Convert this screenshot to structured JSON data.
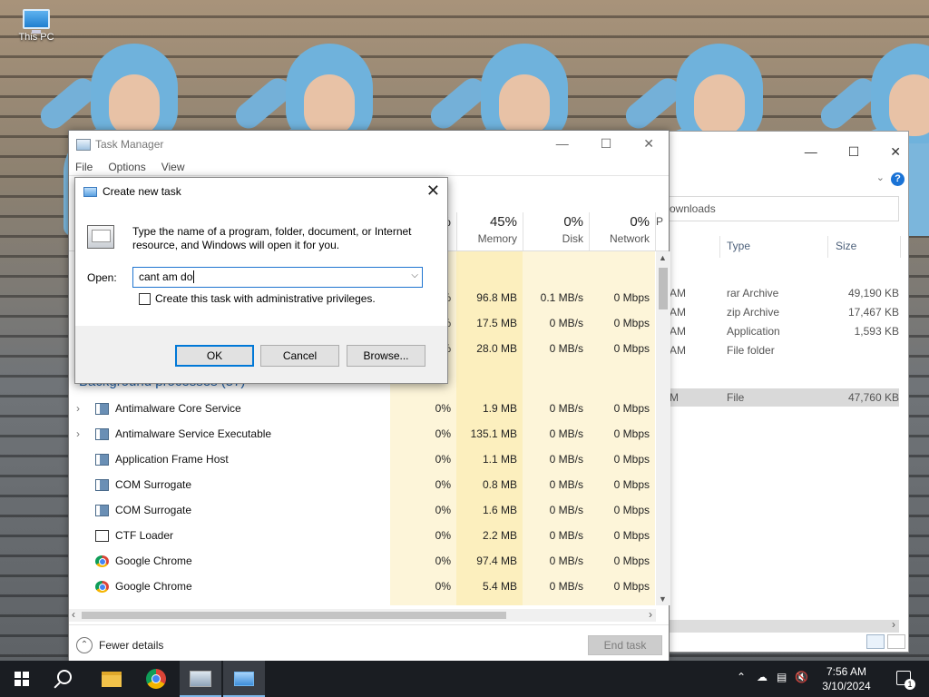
{
  "desktop": {
    "icons": [
      {
        "label": "This PC",
        "icon": "this-pc-icon"
      }
    ]
  },
  "explorer": {
    "address": "ownloads",
    "columns": [
      "Type",
      "Size"
    ],
    "rows": [
      {
        "date": "AM",
        "type": "rar Archive",
        "size": "49,190 KB"
      },
      {
        "date": "AM",
        "type": "zip Archive",
        "size": "17,467 KB"
      },
      {
        "date": "AM",
        "type": "Application",
        "size": "1,593 KB"
      },
      {
        "date": "AM",
        "type": "File folder",
        "size": ""
      },
      {
        "date": "M",
        "type": "File",
        "size": "47,760 KB",
        "selected": true
      }
    ]
  },
  "taskManager": {
    "title": "Task Manager",
    "menu": [
      "File",
      "Options",
      "View"
    ],
    "columns": [
      {
        "pct": "%",
        "label": ""
      },
      {
        "pct": "45%",
        "label": "Memory"
      },
      {
        "pct": "0%",
        "label": "Disk"
      },
      {
        "pct": "0%",
        "label": "Network"
      },
      {
        "pct": "",
        "label": "P"
      }
    ],
    "appRows": [
      {
        "cpu": "%",
        "memory": "96.8 MB",
        "disk": "0.1 MB/s",
        "network": "0 Mbps"
      },
      {
        "cpu": "%",
        "memory": "17.5 MB",
        "disk": "0 MB/s",
        "network": "0 Mbps"
      },
      {
        "cpu": "%",
        "memory": "28.0 MB",
        "disk": "0 MB/s",
        "network": "0 Mbps"
      }
    ],
    "backgroundHeader": "Background processes (57)",
    "processes": [
      {
        "name": "Antimalware Core Service",
        "expandable": true,
        "icon": "service-icon",
        "cpu": "0%",
        "memory": "1.9 MB",
        "disk": "0 MB/s",
        "network": "0 Mbps"
      },
      {
        "name": "Antimalware Service Executable",
        "expandable": true,
        "icon": "service-icon",
        "cpu": "0%",
        "memory": "135.1 MB",
        "disk": "0 MB/s",
        "network": "0 Mbps"
      },
      {
        "name": "Application Frame Host",
        "expandable": false,
        "icon": "service-icon",
        "cpu": "0%",
        "memory": "1.1 MB",
        "disk": "0 MB/s",
        "network": "0 Mbps"
      },
      {
        "name": "COM Surrogate",
        "expandable": false,
        "icon": "service-icon",
        "cpu": "0%",
        "memory": "0.8 MB",
        "disk": "0 MB/s",
        "network": "0 Mbps"
      },
      {
        "name": "COM Surrogate",
        "expandable": false,
        "icon": "service-icon",
        "cpu": "0%",
        "memory": "1.6 MB",
        "disk": "0 MB/s",
        "network": "0 Mbps"
      },
      {
        "name": "CTF Loader",
        "expandable": false,
        "icon": "ctf-loader-icon",
        "cpu": "0%",
        "memory": "2.2 MB",
        "disk": "0 MB/s",
        "network": "0 Mbps"
      },
      {
        "name": "Google Chrome",
        "expandable": false,
        "icon": "chrome-icon",
        "cpu": "0%",
        "memory": "97.4 MB",
        "disk": "0 MB/s",
        "network": "0 Mbps"
      },
      {
        "name": "Google Chrome",
        "expandable": false,
        "icon": "chrome-icon",
        "cpu": "0%",
        "memory": "5.4 MB",
        "disk": "0 MB/s",
        "network": "0 Mbps"
      }
    ],
    "fewerDetails": "Fewer details",
    "endTask": "End task"
  },
  "runDialog": {
    "title": "Create new task",
    "description": "Type the name of a program, folder, document, or Internet resource, and Windows will open it for you.",
    "openLabel": "Open:",
    "inputValue": "cant am do",
    "adminCheckbox": "Create this task with administrative privileges.",
    "ok": "OK",
    "cancel": "Cancel",
    "browse": "Browse..."
  },
  "taskbar": {
    "pinned": [
      "start-icon",
      "search-icon",
      "file-explorer-icon",
      "chrome-icon",
      "task-manager-icon",
      "run-icon"
    ],
    "time": "7:56 AM",
    "date": "3/10/2024",
    "notifications": "1"
  }
}
